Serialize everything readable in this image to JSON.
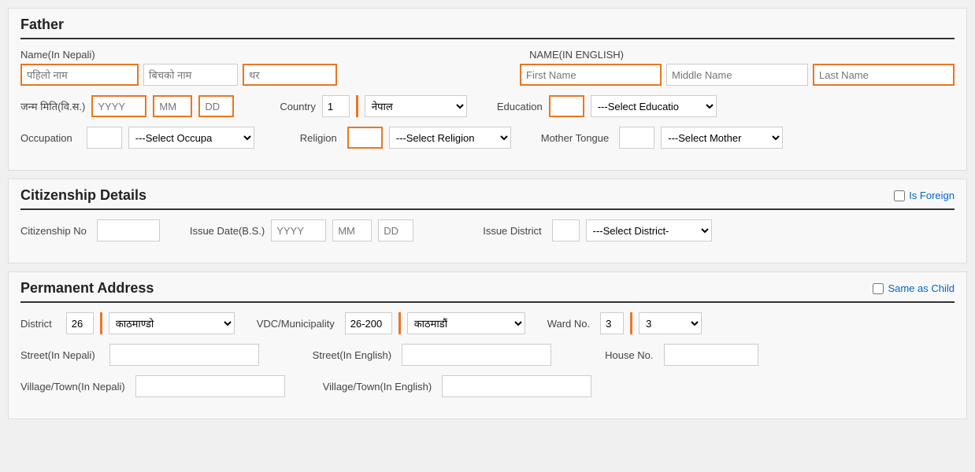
{
  "father": {
    "title": "Father",
    "name_nepali_label": "Name(In Nepali)",
    "name_english_label": "NAME(IN ENGLISH)",
    "first_name_nepali_placeholder": "पहिलो नाम",
    "middle_name_nepali_placeholder": "बिचको नाम",
    "last_name_nepali_placeholder": "थर",
    "first_name_english_placeholder": "First Name",
    "middle_name_english_placeholder": "Middle Name",
    "last_name_english_placeholder": "Last Name",
    "dob_label": "जन्म मिति(वि.स.)",
    "yyyy_placeholder": "YYYY",
    "mm_placeholder": "MM",
    "dd_placeholder": "DD",
    "country_label": "Country",
    "country_code": "1",
    "country_value": "नेपाल",
    "education_label": "Education",
    "education_code": "",
    "education_select_default": "---Select Educatio",
    "occupation_label": "Occupation",
    "occupation_code": "",
    "occupation_select_default": "---Select Occupa",
    "religion_label": "Religion",
    "religion_code": "",
    "religion_select_default": "---Select Religion",
    "mother_tongue_label": "Mother Tongue",
    "mother_tongue_code": "",
    "mother_tongue_select_default": "---Select Mother"
  },
  "citizenship": {
    "title": "Citizenship Details",
    "is_foreign_label": "Is Foreign",
    "citizenship_no_label": "Citizenship No",
    "issue_date_label": "Issue Date(B.S.)",
    "yyyy_placeholder": "YYYY",
    "mm_placeholder": "MM",
    "dd_placeholder": "DD",
    "issue_district_label": "Issue District",
    "issue_district_code": "",
    "issue_district_select_default": "---Select District-"
  },
  "permanent_address": {
    "title": "Permanent Address",
    "same_as_child_label": "Same as Child",
    "district_label": "District",
    "district_code": "26",
    "district_value": "काठमाण्डो",
    "vdc_label": "VDC/Municipality",
    "vdc_code": "26-200",
    "vdc_value": "काठमाडौं",
    "ward_label": "Ward No.",
    "ward_code": "3",
    "ward_value": "3",
    "street_nepali_label": "Street(In Nepali)",
    "street_nepali_value": "",
    "street_english_label": "Street(In English)",
    "street_english_value": "",
    "house_no_label": "House No.",
    "house_no_value": "",
    "village_nepali_label": "Village/Town(In Nepali)",
    "village_nepali_value": "",
    "village_english_label": "Village/Town(In English)",
    "village_english_value": ""
  }
}
